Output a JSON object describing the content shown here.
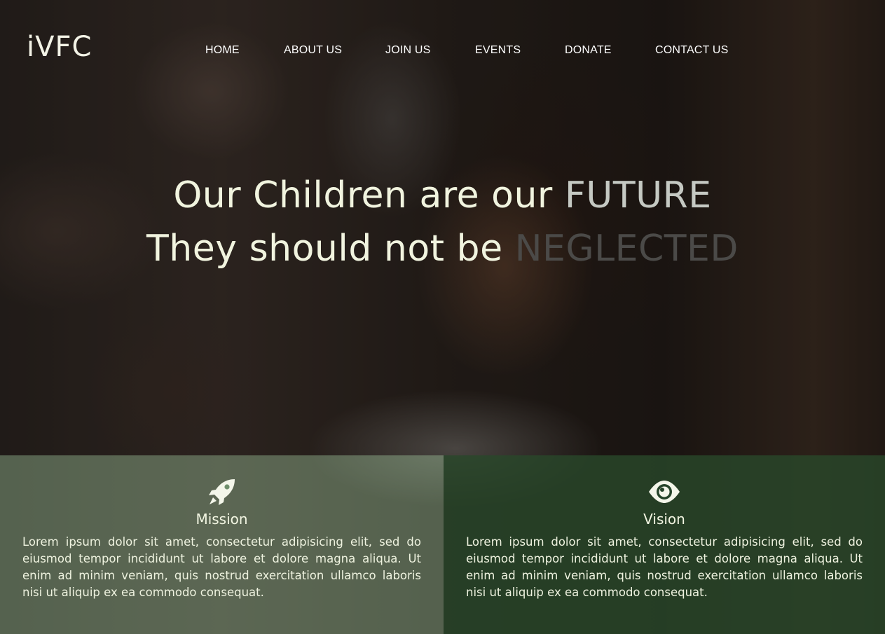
{
  "header": {
    "logo": "iVFC",
    "nav": [
      {
        "label": "HOME"
      },
      {
        "label": "ABOUT US"
      },
      {
        "label": "JOIN US"
      },
      {
        "label": "EVENTS"
      },
      {
        "label": "DONATE"
      },
      {
        "label": "CONTACT US"
      }
    ]
  },
  "hero": {
    "line1_lead": "Our Children are our ",
    "line1_accent": "FUTURE",
    "line2_lead": "They should not be ",
    "line2_accent": "NEGLECTED"
  },
  "panels": [
    {
      "icon": "rocket-icon",
      "title": "Mission",
      "text": "Lorem ipsum dolor sit amet, consectetur adipisicing elit, sed do eiusmod tempor incididunt ut labore et dolore magna aliqua. Ut enim ad minim veniam, quis nostrud exercitation ullamco laboris nisi ut aliquip ex ea commodo consequat."
    },
    {
      "icon": "eye-icon",
      "title": "Vision",
      "text": "Lorem ipsum dolor sit amet, consectetur adipisicing elit, sed do eiusmod tempor incididunt ut labore et dolore magna aliqua. Ut enim ad minim veniam, quis nostrud exercitation ullamco laboris nisi ut aliquip ex ea commodo consequat."
    }
  ],
  "colors": {
    "mission_panel": "#6f8f6c",
    "vision_panel": "#26442a",
    "text_light": "#f1f4df",
    "accent_future": "#c5c9c3",
    "accent_neglected": "#4b4a48"
  }
}
